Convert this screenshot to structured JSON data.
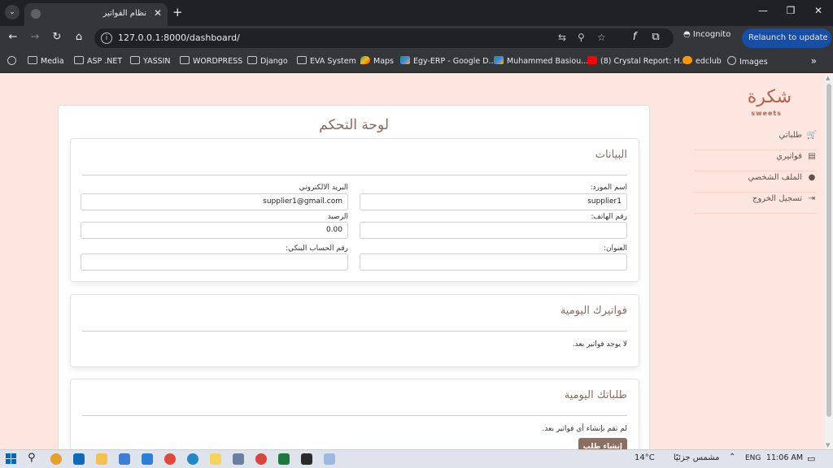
{
  "browser": {
    "tab_title": "نظام الفواتير",
    "url": "127.0.0.1:8000/dashboard/",
    "incognito_label": "Incognito",
    "relaunch_label": "Relaunch to update"
  },
  "bookmarks": [
    "Media",
    "ASP .NET",
    "YASSIN",
    "WORDPRESS",
    "Django",
    "EVA System",
    "Maps",
    "Egy-ERP - Google D...",
    "Muhammed Basiou...",
    "(8) Crystal Report: H...",
    "edclub",
    "Images"
  ],
  "logo": {
    "word": "شكرة",
    "sub": "sweets"
  },
  "sidebar": {
    "items": [
      {
        "label": "طلباتي"
      },
      {
        "label": "فواتيري"
      },
      {
        "label": "الملف الشخصي"
      },
      {
        "label": "تسجيل الخروج"
      }
    ]
  },
  "main": {
    "title": "لوحة التحكم",
    "data_card": {
      "title": "البيانات",
      "supplier_name_label": "اسم المورد:",
      "supplier_name_value": "supplier1",
      "email_label": "البريد الالكتروني",
      "email_value": "supplier1@gmail.com",
      "phone_label": "رقم الهاتف:",
      "phone_value": "",
      "balance_label": "الرصيد",
      "balance_value": "0.00",
      "address_label": "العنوان:",
      "address_value": "",
      "bank_account_label": "رقم الحساب البنكي:",
      "bank_account_value": ""
    },
    "invoices_card": {
      "title": "فواتيرك اليومية",
      "empty_text": "لا يوجد فواتير بعد."
    },
    "orders_card": {
      "title": "طلباتك اليومية",
      "empty_text": "لم تقم بإنشاء أي فواتير بعد.",
      "create_button": "إنشاء طلب"
    }
  },
  "taskbar": {
    "temperature": "14°C",
    "weather": "مشمس جزئيًا",
    "language": "ENG",
    "time": "11:06 AM"
  }
}
